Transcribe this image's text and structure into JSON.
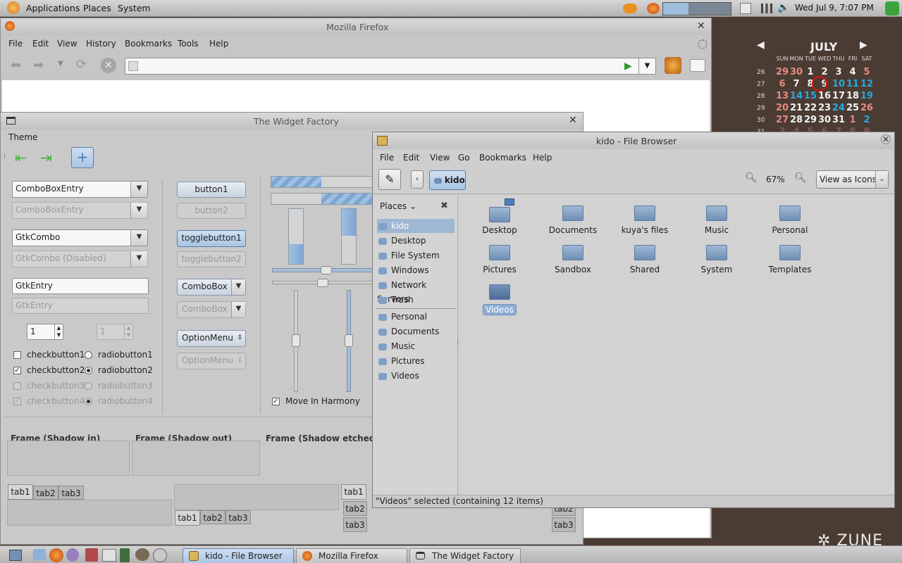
{
  "top_panel": {
    "menus": [
      "Applications",
      "Places",
      "System"
    ],
    "clock": "Wed Jul  9,  7:07 PM"
  },
  "calendar": {
    "month": "JULY",
    "weekdays": [
      "SUN",
      "MON",
      "TUE",
      "WED",
      "THU",
      "FRI",
      "SAT"
    ],
    "weeks": [
      {
        "week": "26",
        "days": [
          "29",
          "30",
          "1",
          "2",
          "3",
          "4",
          "5"
        ]
      },
      {
        "week": "27",
        "days": [
          "6",
          "7",
          "8",
          "9",
          "10",
          "11",
          "12"
        ]
      },
      {
        "week": "28",
        "days": [
          "13",
          "14",
          "15",
          "16",
          "17",
          "18",
          "19"
        ]
      },
      {
        "week": "29",
        "days": [
          "20",
          "21",
          "22",
          "23",
          "24",
          "25",
          "26"
        ]
      },
      {
        "week": "30",
        "days": [
          "27",
          "28",
          "29",
          "30",
          "31",
          "1",
          "2"
        ]
      },
      {
        "week": "31",
        "days": [
          "3",
          "4",
          "5",
          "6",
          "7",
          "8",
          "9"
        ]
      }
    ],
    "today": "9",
    "colors": {
      "weekend": "#e88a80",
      "highlight": "#2aa7dd",
      "normal": "#f2f2f2",
      "today_ring": "#d11"
    }
  },
  "firefox": {
    "title": "Mozilla Firefox",
    "menus": [
      "File",
      "Edit",
      "View",
      "History",
      "Bookmarks",
      "Tools",
      "Help"
    ],
    "url_value": ""
  },
  "widget_factory": {
    "title": "The Widget Factory",
    "menu": "Theme",
    "combo_entries": [
      "ComboBoxEntry",
      "ComboBoxEntry",
      "GtkCombo",
      "GtkCombo (Disabled)"
    ],
    "entries": [
      "GtkEntry",
      "GtkEntry"
    ],
    "spin_values": [
      "1",
      "1"
    ],
    "checks": [
      {
        "label": "checkbutton1",
        "checked": false
      },
      {
        "label": "checkbutton2",
        "checked": true
      },
      {
        "label": "checkbutton3",
        "checked": false
      },
      {
        "label": "checkbutton4",
        "checked": true
      }
    ],
    "radios": [
      {
        "label": "radiobutton1",
        "on": false
      },
      {
        "label": "radiobutton2",
        "on": true
      },
      {
        "label": "radiobutton3",
        "on": false
      },
      {
        "label": "radiobutton4",
        "on": true
      }
    ],
    "buttons": [
      "button1",
      "button2",
      "togglebutton1",
      "togglebutton2",
      "ComboBox",
      "ComboBox",
      "OptionMenu",
      "OptionMenu"
    ],
    "harmony": "Move In Harmony",
    "frames": [
      "Frame (Shadow in)",
      "Frame (Shadow out)",
      "Frame (Shadow etched in)"
    ],
    "tabs": [
      "tab1",
      "tab2",
      "tab3"
    ]
  },
  "file_browser": {
    "title": "kido - File Browser",
    "menus": [
      "File",
      "Edit",
      "View",
      "Go",
      "Bookmarks",
      "Help"
    ],
    "location": "kido",
    "zoom": "67%",
    "view_mode": "View as Icons",
    "places_label": "Places",
    "places": [
      "kido",
      "Desktop",
      "File System",
      "Windows",
      "Network Servers",
      "Trash"
    ],
    "bookmarks": [
      "Personal",
      "Documents",
      "Music",
      "Pictures",
      "Videos"
    ],
    "icons": [
      "Desktop",
      "Documents",
      "kuya's files",
      "Music",
      "Personal",
      "Pictures",
      "Sandbox",
      "Shared",
      "System",
      "Templates",
      "Videos"
    ],
    "selected": "Videos",
    "status": "\"Videos\" selected (containing 12 items)"
  },
  "taskbar": {
    "tasks": [
      "kido - File Browser",
      "Mozilla Firefox",
      "The Widget Factory"
    ],
    "active": "kido - File Browser"
  },
  "desktop": {
    "brand": "ZUNE"
  }
}
